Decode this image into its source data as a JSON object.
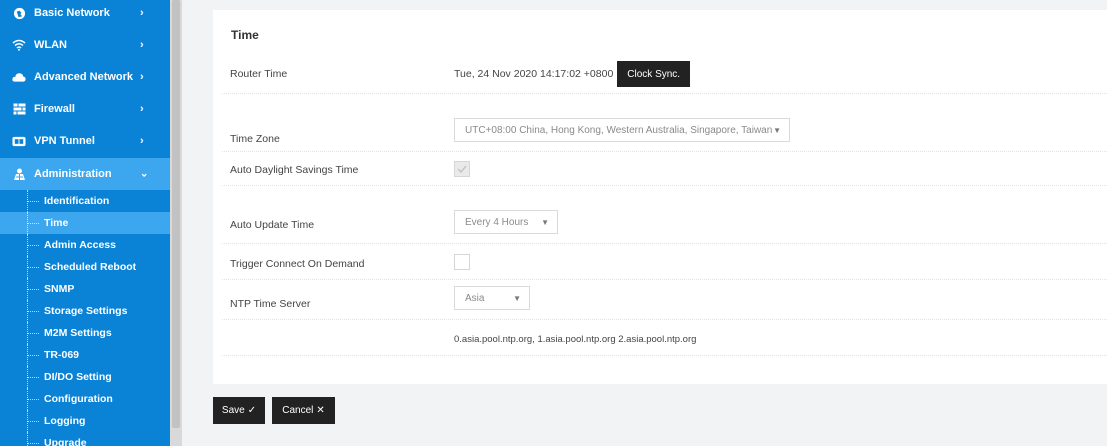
{
  "sidebar": {
    "items": [
      {
        "label": "Basic Network",
        "icon": "globe-icon"
      },
      {
        "label": "WLAN",
        "icon": "wifi-icon"
      },
      {
        "label": "Advanced Network",
        "icon": "cloud-icon"
      },
      {
        "label": "Firewall",
        "icon": "firewall-icon"
      },
      {
        "label": "VPN Tunnel",
        "icon": "vpn-icon"
      },
      {
        "label": "Administration",
        "icon": "admin-icon"
      }
    ],
    "sub_items": [
      "Identification",
      "Time",
      "Admin Access",
      "Scheduled Reboot",
      "SNMP",
      "Storage Settings",
      "M2M Settings",
      "TR-069",
      "DI/DO Setting",
      "Configuration",
      "Logging",
      "Upgrade"
    ],
    "active_sub_item": "Time"
  },
  "main": {
    "title": "Time",
    "router_time": {
      "label": "Router Time",
      "value": "Tue, 24 Nov 2020 14:17:02 +0800",
      "button": "Clock Sync."
    },
    "time_zone": {
      "label": "Time Zone",
      "value": "UTC+08:00 China, Hong Kong, Western Australia, Singapore, Taiwan"
    },
    "auto_dst": {
      "label": "Auto Daylight Savings Time",
      "checked": true
    },
    "auto_update": {
      "label": "Auto Update Time",
      "value": "Every 4 Hours"
    },
    "trigger_connect": {
      "label": "Trigger Connect On Demand",
      "checked": false
    },
    "ntp_server": {
      "label": "NTP Time Server",
      "value": "Asia",
      "servers": "0.asia.pool.ntp.org, 1.asia.pool.ntp.org 2.asia.pool.ntp.org"
    }
  },
  "footer": {
    "save": "Save",
    "cancel": "Cancel"
  },
  "colors": {
    "sidebar_bg": "#0a82d6",
    "sidebar_active": "#3ca6ef",
    "button_dark": "#222222"
  }
}
